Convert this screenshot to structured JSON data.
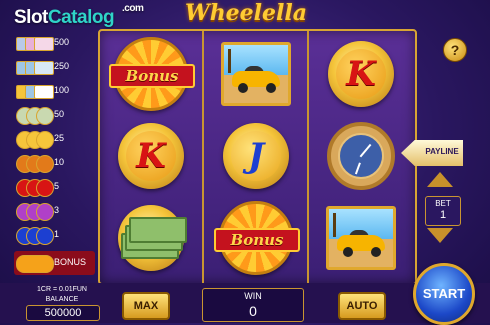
{
  "watermark": {
    "prefix": "Slot",
    "accent": "Catalog",
    "suffix": ".com"
  },
  "game": {
    "title": "Wheelella"
  },
  "help": {
    "label": "?"
  },
  "paytable": [
    {
      "value": "500"
    },
    {
      "value": "250"
    },
    {
      "value": "100"
    },
    {
      "value": "50"
    },
    {
      "value": "25"
    },
    {
      "value": "10"
    },
    {
      "value": "5"
    },
    {
      "value": "3"
    },
    {
      "value": "1"
    },
    {
      "value": "BONUS"
    }
  ],
  "reels": {
    "symbols": [
      [
        "bonus-wheel",
        "k-coin",
        "money-stack"
      ],
      [
        "car",
        "j-coin",
        "bonus-wheel"
      ],
      [
        "k-coin",
        "watch",
        "car"
      ]
    ],
    "bonus_label": "Bonus",
    "k_letter": "K",
    "j_letter": "J"
  },
  "payline": {
    "label": "PAYLINE"
  },
  "bet": {
    "label": "BET",
    "value": "1"
  },
  "info": {
    "rate": "1CR = 0.01FUN",
    "balance_label": "BALANCE",
    "balance_value": "500000"
  },
  "buttons": {
    "max": "MAX",
    "auto": "AUTO",
    "start": "START"
  },
  "win": {
    "label": "WIN",
    "value": "0"
  },
  "colors": {
    "gold": "#d8a534",
    "background": "#2a1760",
    "bonus_red": "#8b0c1b",
    "start_blue": "#1c48c8"
  }
}
